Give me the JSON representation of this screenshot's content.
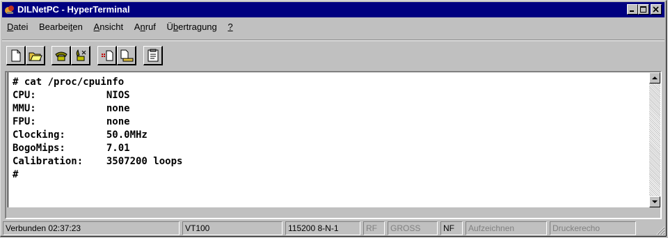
{
  "window": {
    "title": "DILNetPC - HyperTerminal",
    "controls": [
      "minimize",
      "maximize",
      "close"
    ]
  },
  "menu": {
    "items": [
      {
        "pre": "",
        "key": "D",
        "post": "atei"
      },
      {
        "pre": "Bearbei",
        "key": "t",
        "post": "en"
      },
      {
        "pre": "",
        "key": "A",
        "post": "nsicht"
      },
      {
        "pre": "A",
        "key": "n",
        "post": "ruf"
      },
      {
        "pre": "Ü",
        "key": "b",
        "post": "ertragung"
      },
      {
        "pre": "",
        "key": "?",
        "post": ""
      }
    ]
  },
  "toolbar": {
    "icons": [
      "new-document-icon",
      "open-folder-icon",
      "connect-phone-icon",
      "disconnect-phone-icon",
      "send-file-icon",
      "receive-file-icon",
      "properties-icon"
    ]
  },
  "terminal": {
    "lines": [
      "# cat /proc/cpuinfo",
      "CPU:            NIOS",
      "MMU:            none",
      "FPU:            none",
      "Clocking:       50.0MHz",
      "BogoMips:       7.01",
      "Calibration:    3507200 loops",
      "#"
    ]
  },
  "status": {
    "connection": "Verbunden 02:37:23",
    "emulation": "VT100",
    "port_settings": "115200 8-N-1",
    "rf": "RF",
    "caps": "GROSS",
    "num": "NF",
    "capture": "Aufzeichnen",
    "print_echo": "Druckerecho"
  },
  "colors": {
    "titlebar": "#000080",
    "face": "#c0c0c0",
    "terminal_bg": "#ffffff",
    "disabled_text": "#808080"
  }
}
